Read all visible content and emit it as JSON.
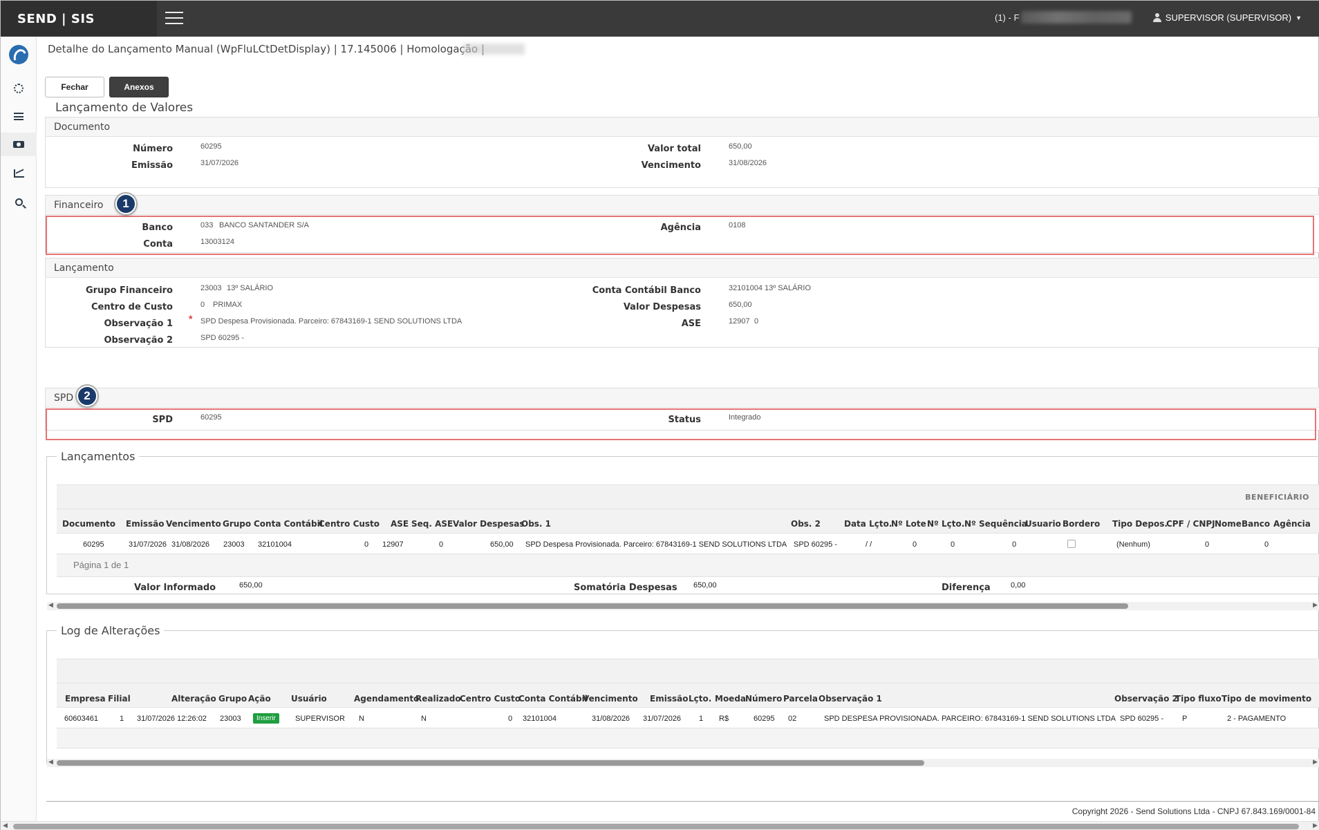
{
  "header": {
    "brand": "SEND | SIS",
    "company": "(1) - F",
    "user": "SUPERVISOR (SUPERVISOR)"
  },
  "page": {
    "breadcrumb": "Detalhe do Lançamento Manual (WpFluLCtDetDisplay) | 17.145006 | Homologação |",
    "buttons": {
      "fechar": "Fechar",
      "anexos": "Anexos"
    },
    "title": "Lançamento de Valores"
  },
  "documento": {
    "heading": "Documento",
    "numero_label": "Número",
    "numero": "60295",
    "emissao_label": "Emissão",
    "emissao": "31/07/2026",
    "valor_total_label": "Valor total",
    "valor_total": "650,00",
    "vencimento_label": "Vencimento",
    "vencimento": "31/08/2026"
  },
  "financeiro": {
    "heading": "Financeiro",
    "marker": "1",
    "banco_label": "Banco",
    "banco_codigo": "033",
    "banco_nome": "BANCO SANTANDER S/A",
    "conta_label": "Conta",
    "conta": "13003124",
    "agencia_label": "Agência",
    "agencia": "0108"
  },
  "lancamento": {
    "heading": "Lançamento",
    "grupo_label": "Grupo Financeiro",
    "grupo_codigo": "23003",
    "grupo_nome": "13º SALÁRIO",
    "centro_label": "Centro de Custo",
    "centro_codigo": "0",
    "centro_nome": "PRIMAX",
    "obs1_label": "Observação 1",
    "obs1_required": "*",
    "obs1": "SPD Despesa Provisionada. Parceiro: 67843169-1 SEND SOLUTIONS LTDA",
    "obs2_label": "Observação 2",
    "obs2": "SPD 60295 -",
    "conta_contabil_label": "Conta Contábil Banco",
    "conta_contabil_codigo": "32101004",
    "conta_contabil_nome": "13º SALÁRIO",
    "valor_despesas_label": "Valor Despesas",
    "valor_despesas": "650,00",
    "ase_label": "ASE",
    "ase_codigo": "12907",
    "ase_seq": "0"
  },
  "spd": {
    "heading": "SPD",
    "marker": "2",
    "spd_label": "SPD",
    "spd": "60295",
    "status_label": "Status",
    "status": "Integrado"
  },
  "lancamentos_grid": {
    "legend": "Lançamentos",
    "group_header": "BENEFICIÁRIO",
    "columns": [
      "Documento",
      "Emissão",
      "Vencimento",
      "Grupo",
      "Conta Contábil",
      "Centro Custo",
      "ASE",
      "Seq. ASE",
      "Valor Despesas",
      "Obs. 1",
      "Obs. 2",
      "Data Lçto.",
      "Nº Lote",
      "Nº Lçto.",
      "Nº Sequência",
      "Usuario",
      "Bordero",
      "Tipo Depos.",
      "CPF / CNPJ",
      "Nome",
      "Banco",
      "Agência"
    ],
    "row": {
      "documento": "60295",
      "emissao": "31/07/2026",
      "vencimento": "31/08/2026",
      "grupo": "23003",
      "conta_contabil": "32101004",
      "centro_custo": "0",
      "ase": "12907",
      "seq_ase": "0",
      "valor_despesas": "650,00",
      "obs1": "SPD Despesa Provisionada. Parceiro: 67843169-1 SEND SOLUTIONS LTDA",
      "obs2": "SPD 60295 -",
      "data_lcto": "/ /",
      "lote": "0",
      "lcto": "0",
      "sequencia": "0",
      "tipo_depos": "(Nenhum)",
      "cpf_cnpj": "0",
      "banco": "0"
    },
    "pager": "Página 1 de 1",
    "totals": {
      "valor_informado_label": "Valor Informado",
      "valor_informado": "650,00",
      "somatoria_label": "Somatória Despesas",
      "somatoria": "650,00",
      "diferenca_label": "Diferença",
      "diferenca": "0,00"
    }
  },
  "log_grid": {
    "legend": "Log de Alterações",
    "columns": [
      "Empresa",
      "Filial",
      "Alteração",
      "Grupo",
      "Ação",
      "Usuário",
      "Agendamento",
      "Realizado",
      "Centro Custo",
      "Conta Contábil",
      "Vencimento",
      "Emissão",
      "Lçto.",
      "Moeda",
      "Número",
      "Parcela",
      "Observação 1",
      "Observação 2",
      "Tipo fluxo",
      "Tipo de movimento"
    ],
    "row": {
      "empresa": "60603461",
      "filial": "1",
      "alteracao": "31/07/2026 12:26:02",
      "grupo": "23003",
      "acao": "Inserir",
      "usuario": "SUPERVISOR",
      "agendamento": "N",
      "realizado": "N",
      "centro_custo": "0",
      "conta_contabil": "32101004",
      "vencimento": "31/08/2026",
      "emissao": "31/07/2026",
      "lcto": "1",
      "moeda": "R$",
      "numero": "60295",
      "parcela": "02",
      "obs1": "SPD DESPESA PROVISIONADA. PARCEIRO: 67843169-1 SEND SOLUTIONS LTDA",
      "obs2": "SPD 60295 -",
      "tipo_fluxo": "P",
      "tipo_movimento": "2 - PAGAMENTO"
    }
  },
  "footer": {
    "copyright": "Copyright 2026 - Send Solutions Ltda - CNPJ 67.843.169/0001-84"
  },
  "colors": {
    "highlight": "#e57373",
    "marker": "#1a3a6a",
    "action_badge": "#1e9e3e",
    "topbar": "#3a3a3a"
  }
}
